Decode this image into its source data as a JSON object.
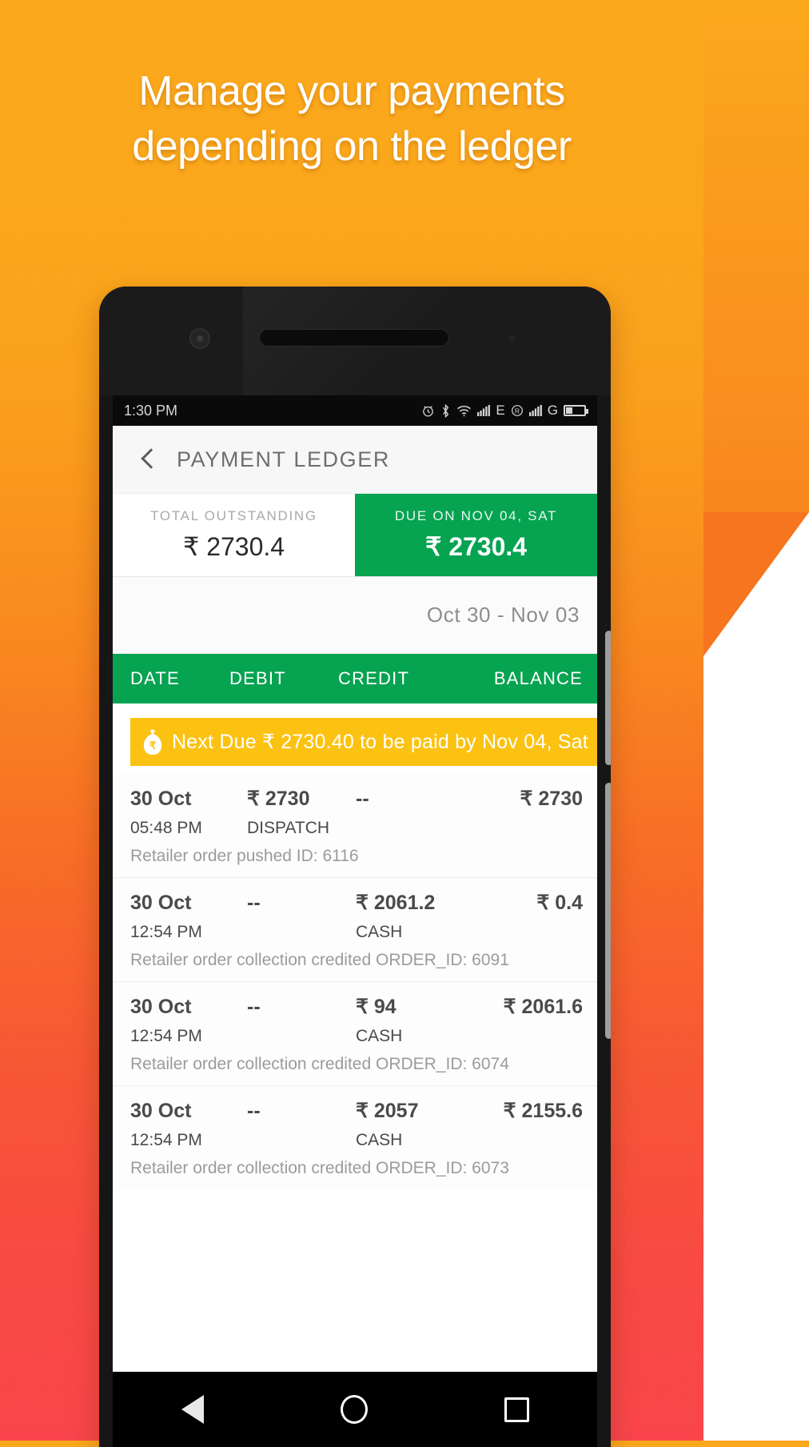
{
  "promo": {
    "headline_line1": "Manage your payments",
    "headline_line2": "depending on the ledger"
  },
  "statusbar": {
    "time": "1:30 PM",
    "icons": [
      "alarm-icon",
      "bluetooth-icon",
      "wifi-icon",
      "signal-icon",
      "edge-network-label",
      "roaming-icon",
      "signal-icon-2",
      "gprs-network-label",
      "battery-icon"
    ],
    "network_labels": [
      "E",
      "R",
      "G"
    ]
  },
  "appbar": {
    "back_label": "back-chevron",
    "title": "PAYMENT LEDGER"
  },
  "summary": {
    "outstanding_label": "TOTAL OUTSTANDING",
    "outstanding_value": "₹ 2730.4",
    "due_label": "DUE ON NOV 04, SAT",
    "due_value": "₹ 2730.4",
    "accent_green": "#06A351"
  },
  "date_range": "Oct 30 -  Nov 03",
  "table": {
    "headers": {
      "date": "DATE",
      "debit": "DEBIT",
      "credit": "CREDIT",
      "balance": "BALANCE"
    },
    "banner": {
      "text": "Next Due ₹ 2730.40 to be paid by Nov 04, Sat",
      "color": "#FCC212",
      "icon": "money-bag-rupee-icon"
    },
    "rows": [
      {
        "date": "30 Oct",
        "time": "05:48 PM",
        "debit": "₹ 2730",
        "credit": "--",
        "balance": "₹ 2730",
        "mode": "DISPATCH",
        "description": "Retailer order pushed ID: 6116"
      },
      {
        "date": "30 Oct",
        "time": "12:54 PM",
        "debit": "--",
        "credit": "₹ 2061.2",
        "balance": "₹ 0.4",
        "mode": "CASH",
        "description": "Retailer order collection credited ORDER_ID: 6091"
      },
      {
        "date": "30 Oct",
        "time": "12:54 PM",
        "debit": "--",
        "credit": "₹ 94",
        "balance": "₹ 2061.6",
        "mode": "CASH",
        "description": "Retailer order collection credited ORDER_ID: 6074"
      },
      {
        "date": "30 Oct",
        "time": "12:54 PM",
        "debit": "--",
        "credit": "₹ 2057",
        "balance": "₹ 2155.6",
        "mode": "CASH",
        "description": "Retailer order collection credited ORDER_ID: 6073"
      }
    ]
  },
  "navbar": {
    "back": "back-triangle-icon",
    "home": "home-circle-icon",
    "recents": "recents-square-icon"
  }
}
